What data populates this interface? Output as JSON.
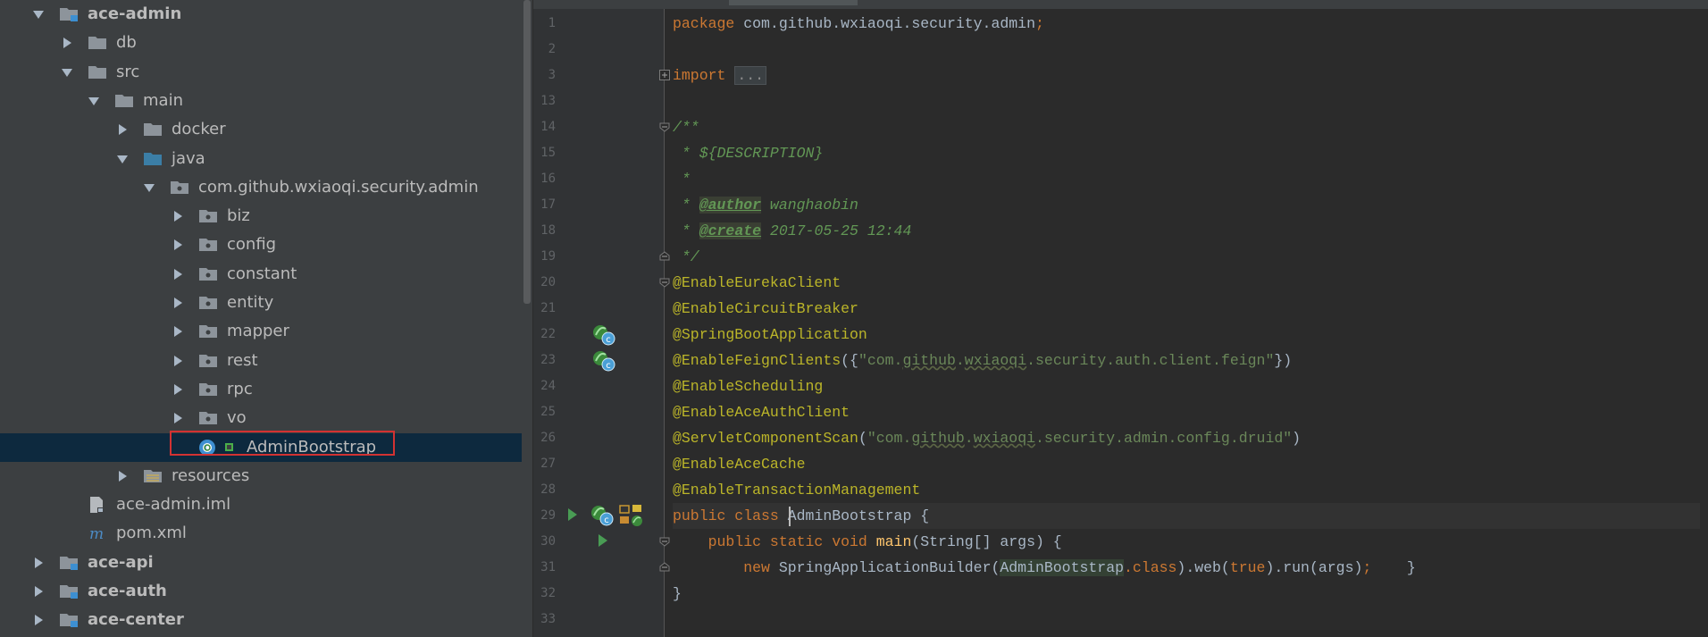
{
  "project_tree": [
    {
      "label": "ace-admin",
      "expanded": true,
      "bold": true,
      "icon": "module-folder-icon"
    },
    {
      "label": "db",
      "expanded": false,
      "bold": false,
      "icon": "folder-icon"
    },
    {
      "label": "src",
      "expanded": true,
      "bold": false,
      "icon": "folder-icon"
    },
    {
      "label": "main",
      "expanded": true,
      "bold": false,
      "icon": "folder-icon"
    },
    {
      "label": "docker",
      "expanded": false,
      "bold": false,
      "icon": "folder-icon"
    },
    {
      "label": "java",
      "expanded": true,
      "bold": false,
      "icon": "source-root-folder-icon"
    },
    {
      "label": "com.github.wxiaoqi.security.admin",
      "expanded": true,
      "bold": false,
      "icon": "package-icon"
    },
    {
      "label": "biz",
      "expanded": false,
      "bold": false,
      "icon": "package-icon"
    },
    {
      "label": "config",
      "expanded": false,
      "bold": false,
      "icon": "package-icon"
    },
    {
      "label": "constant",
      "expanded": false,
      "bold": false,
      "icon": "package-icon"
    },
    {
      "label": "entity",
      "expanded": false,
      "bold": false,
      "icon": "package-icon"
    },
    {
      "label": "mapper",
      "expanded": false,
      "bold": false,
      "icon": "package-icon"
    },
    {
      "label": "rest",
      "expanded": false,
      "bold": false,
      "icon": "package-icon"
    },
    {
      "label": "rpc",
      "expanded": false,
      "bold": false,
      "icon": "package-icon"
    },
    {
      "label": "vo",
      "expanded": false,
      "bold": false,
      "icon": "package-icon"
    },
    {
      "label": "AdminBootstrap",
      "expanded": null,
      "bold": false,
      "icon": "spring-boot-class-icon",
      "selected": true
    },
    {
      "label": "resources",
      "expanded": false,
      "bold": false,
      "icon": "resources-folder-icon"
    },
    {
      "label": "ace-admin.iml",
      "expanded": null,
      "bold": false,
      "icon": "iml-file-icon"
    },
    {
      "label": "pom.xml",
      "expanded": null,
      "bold": false,
      "icon": "maven-icon"
    },
    {
      "label": "ace-api",
      "expanded": false,
      "bold": true,
      "icon": "module-folder-icon"
    },
    {
      "label": "ace-auth",
      "expanded": false,
      "bold": true,
      "icon": "module-folder-icon"
    },
    {
      "label": "ace-center",
      "expanded": false,
      "bold": true,
      "icon": "module-folder-icon"
    }
  ],
  "editor": {
    "line_numbers": [
      "1",
      "2",
      "3",
      "13",
      "14",
      "15",
      "16",
      "17",
      "18",
      "19",
      "20",
      "21",
      "22",
      "23",
      "24",
      "25",
      "26",
      "27",
      "28",
      "29",
      "30",
      "31",
      "32",
      "33"
    ],
    "code": {
      "package_kw": "package",
      "package_name": " com.github.wxiaoqi.security.admin",
      "semicolon": ";",
      "import_kw": "import ",
      "import_fold": "...",
      "doc_open": "/**",
      "doc_description": " * ${DESCRIPTION}",
      "doc_star": " *",
      "doc_prefix": " * ",
      "doc_author_tag": "@author",
      "doc_author_value": " wanghaobin",
      "doc_create_tag": "@create",
      "doc_create_value": " 2017-05-25 12:44",
      "doc_close": " */",
      "ann_eureka": "@EnableEurekaClient",
      "ann_circuit": "@EnableCircuitBreaker",
      "ann_springboot": "@SpringBootApplication",
      "ann_feign": "@EnableFeignClients",
      "feign_open": "({",
      "feign_str_q1": "\"com.",
      "feign_str_github": "github",
      "feign_str_dot": ".",
      "feign_str_wxiaoqi": "wxiaoqi",
      "feign_str_rest": ".security.auth.client.feign\"",
      "feign_close": "})",
      "ann_scheduling": "@EnableScheduling",
      "ann_aceauth": "@EnableAceAuthClient",
      "ann_servlet": "@ServletComponentScan",
      "servlet_open": "(",
      "servlet_str_q1": "\"com.",
      "servlet_str_github": "github",
      "servlet_str_dot": ".",
      "servlet_str_wxiaoqi": "wxiaoqi",
      "servlet_str_rest": ".security.admin.config.druid\"",
      "servlet_close": ")",
      "ann_acecache": "@EnableAceCache",
      "ann_tx": "@EnableTransactionManagement",
      "class_kw": "public class ",
      "class_name": "AdminBootstrap",
      "class_brace": " {",
      "main_indent": "    ",
      "main_kw": "public static void ",
      "main_name": "main",
      "main_sig": "(String[] args) {",
      "body_indent": "        ",
      "body_new": "new ",
      "body_builder": "SpringApplicationBuilder(",
      "body_cls": "AdminBootstrap",
      "body_dot_class": ".class",
      "body_web": ").web(",
      "body_true": "true",
      "body_run": ").run(args)",
      "body_semicolon": ";",
      "body_close": "    }",
      "close_brace": "}"
    }
  },
  "colors": {
    "tree_bg": "#3c3f41",
    "editor_bg": "#2b2b2b",
    "gutter_bg": "#313335",
    "selection": "#0d293e",
    "highlight_box": "#d23232",
    "keyword": "#cc7832",
    "annotation": "#bbb529",
    "string": "#6a8759",
    "doc_comment": "#629755",
    "run_green": "#499c54"
  }
}
